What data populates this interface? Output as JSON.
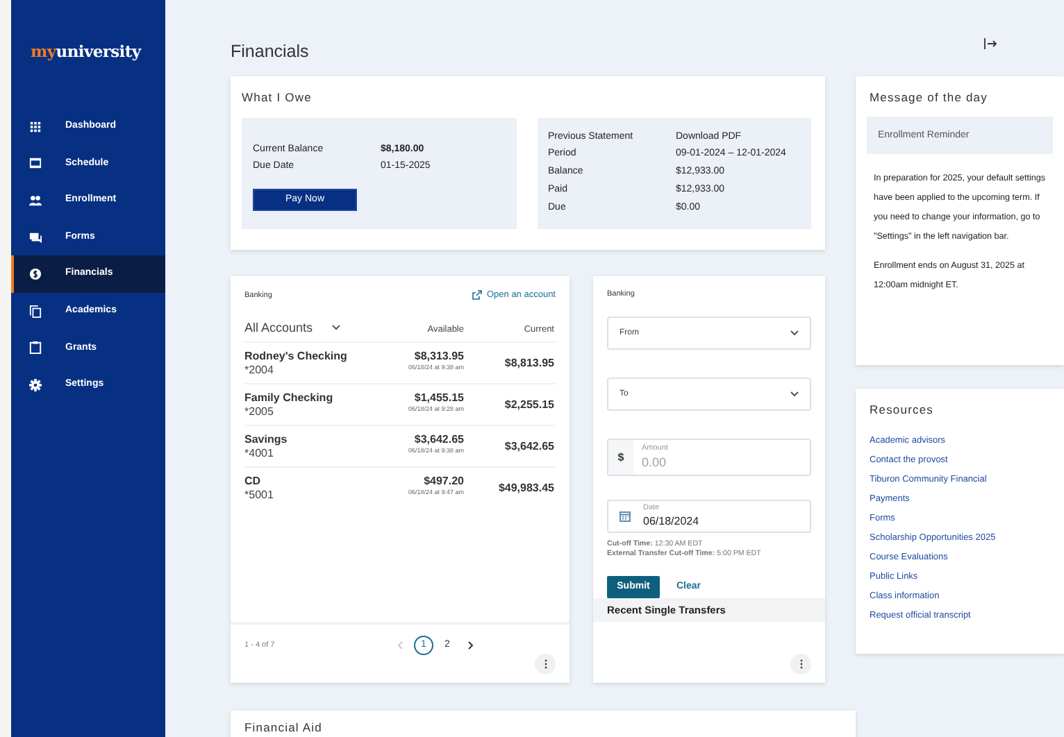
{
  "sidebar": {
    "logo": {
      "accent": "my",
      "rest": "university"
    },
    "items": [
      {
        "label": "Dashboard",
        "selected": false
      },
      {
        "label": "Schedule",
        "selected": false
      },
      {
        "label": "Enrollment",
        "selected": false
      },
      {
        "label": "Forms",
        "selected": false
      },
      {
        "label": "Financials",
        "selected": true
      },
      {
        "label": "Academics",
        "selected": false
      },
      {
        "label": "Grants",
        "selected": false
      },
      {
        "label": "Settings",
        "selected": false
      }
    ]
  },
  "page": {
    "title": "Financials"
  },
  "what_i_owe": {
    "title": "What I Owe",
    "current": [
      {
        "label": "Current Balance",
        "value": "$8,180.00",
        "strong": true
      },
      {
        "label": "Due Date",
        "value": "01-15-2025",
        "strong": false
      }
    ],
    "pay_button": "Pay Now",
    "statement": [
      {
        "label": "Previous Statement",
        "value": "Download PDF"
      },
      {
        "label": "Period",
        "value": "09-01-2024 – 12-01-2024"
      },
      {
        "label": "Balance",
        "value": "$12,933.00"
      },
      {
        "label": "Paid",
        "value": "$12,933.00"
      },
      {
        "label": "Due",
        "value": "$0.00"
      }
    ]
  },
  "accounts": {
    "title": "Banking",
    "open_link": "Open an account",
    "filter": "All Accounts",
    "columns": [
      "Available",
      "Current"
    ],
    "rows": [
      {
        "name": "Rodney's Checking",
        "number": "*2004",
        "available": "$8,313.95",
        "updated": "06/18/24 at 9:38 am",
        "current": "$8,813.95"
      },
      {
        "name": "Family Checking",
        "number": "*2005",
        "available": "$1,455.15",
        "updated": "06/18/24 at 9:28 am",
        "current": "$2,255.15"
      },
      {
        "name": "Savings",
        "number": "*4001",
        "available": "$3,642.65",
        "updated": "06/18/24 at 9:38 am",
        "current": "$3,642.65"
      },
      {
        "name": "CD",
        "number": "*5001",
        "available": "$497.20",
        "updated": "06/18/24 at 9:47 am",
        "current": "$49,983.45"
      }
    ],
    "range": "1 - 4 of 7",
    "prev_disabled": true,
    "pages": [
      {
        "label": "1",
        "selected": true
      },
      {
        "label": "2",
        "selected": false
      }
    ]
  },
  "transfer": {
    "title": "Banking",
    "fields": [
      {
        "kind": "select",
        "label": "From"
      },
      {
        "kind": "select",
        "label": "To"
      },
      {
        "kind": "amount",
        "prefix": "$",
        "label": "Amount",
        "placeholder": "0.00"
      },
      {
        "kind": "date",
        "label": "Date",
        "value": "06/18/2024"
      }
    ],
    "cutoff": [
      "**Cut-off Time:** 12:30 AM EDT",
      "**External Transfer Cut-off Time:** 5:00 PM EDT"
    ],
    "submit": "Submit",
    "clear": "Clear",
    "recent_title": "Recent Single Transfers"
  },
  "message": {
    "title": "Message of the day",
    "subject": "Enrollment Reminder",
    "paragraphs": [
      "In preparation for 2025, your default settings have been applied to the upcoming term. If you need to change your information, go to \"Settings\" in the left navigation bar.",
      "Enrollment ends on August 31, 2025 at 12:00am midnight ET."
    ]
  },
  "resources": {
    "title": "Resources",
    "links": [
      "Academic advisors",
      "Contact the provost",
      "Tiburon Community Financial",
      "Payments",
      "Forms",
      "Scholarship Opportunities 2025",
      "Course Evaluations",
      "Public Links",
      "Class information",
      "Request official transcript"
    ]
  },
  "financial_aid": {
    "title": "Financial Aid"
  }
}
